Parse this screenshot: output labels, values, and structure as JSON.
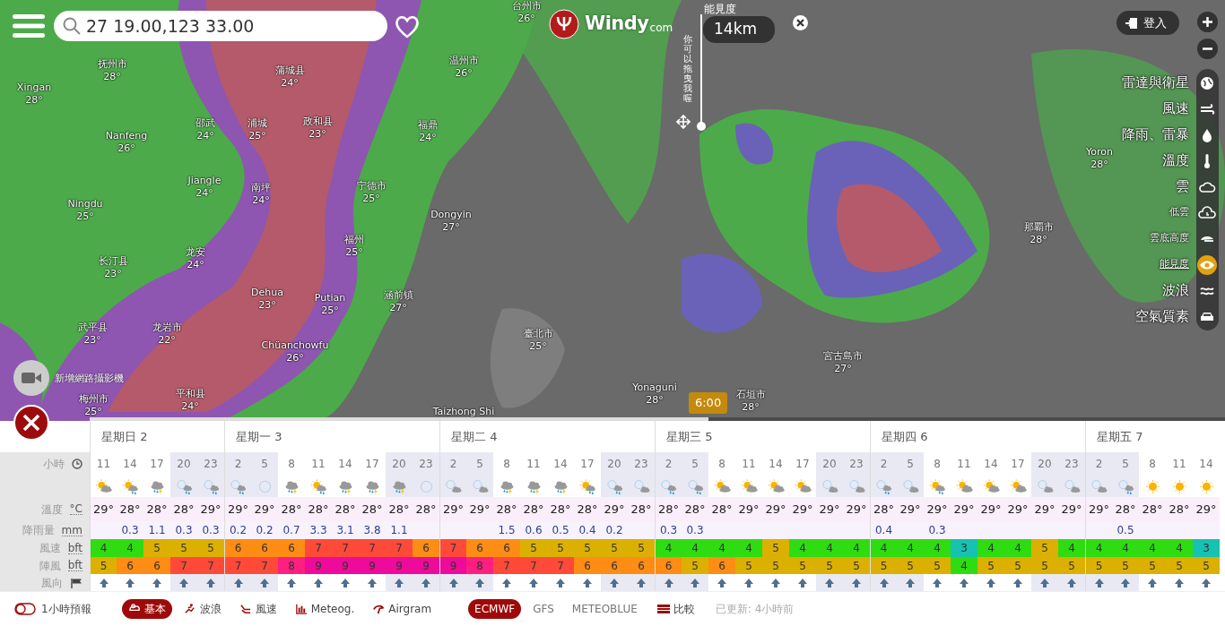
{
  "search": {
    "value": "27 19.00,123 33.00"
  },
  "logo": {
    "name": "Windy",
    "suffix": "com"
  },
  "visibility_widget": {
    "label": "能見度",
    "value": "14km",
    "hint": "你可以拖曳我喔"
  },
  "login": {
    "label": "登入"
  },
  "layers": [
    {
      "label": "雷達與衛星",
      "kind": "major",
      "selected": false
    },
    {
      "label": "風速",
      "kind": "major",
      "selected": false
    },
    {
      "label": "降雨、雷暴",
      "kind": "major",
      "selected": false
    },
    {
      "label": "溫度",
      "kind": "major",
      "selected": false
    },
    {
      "label": "雲",
      "kind": "major",
      "selected": false
    },
    {
      "label": "低雲",
      "kind": "minor",
      "selected": false
    },
    {
      "label": "雲底高度",
      "kind": "minor",
      "selected": false
    },
    {
      "label": "能見度",
      "kind": "minor",
      "selected": true
    },
    {
      "label": "波浪",
      "kind": "major",
      "selected": false
    },
    {
      "label": "空氣質素",
      "kind": "major",
      "selected": false
    }
  ],
  "cities": [
    {
      "name": "抚州市",
      "temp": "28°"
    },
    {
      "name": "Xingan",
      "temp": "28°"
    },
    {
      "name": "蒲城县",
      "temp": "24°"
    },
    {
      "name": "温州市",
      "temp": "26°"
    },
    {
      "name": "台州市",
      "temp": "26°"
    },
    {
      "name": "邵武",
      "temp": "24°"
    },
    {
      "name": "浦城",
      "temp": "25°"
    },
    {
      "name": "政和县",
      "temp": "23°"
    },
    {
      "name": "福鼎",
      "temp": "24°"
    },
    {
      "name": "Nanfeng",
      "temp": "26°"
    },
    {
      "name": "Jiangle",
      "temp": "24°"
    },
    {
      "name": "南坪",
      "temp": "24°"
    },
    {
      "name": "宁德市",
      "temp": "25°"
    },
    {
      "name": "Ningdu",
      "temp": "25°"
    },
    {
      "name": "Dongyin",
      "temp": "27°"
    },
    {
      "name": "福州",
      "temp": "25°"
    },
    {
      "name": "长汀县",
      "temp": "23°"
    },
    {
      "name": "龙安",
      "temp": "24°"
    },
    {
      "name": "Dehua",
      "temp": "23°"
    },
    {
      "name": "Putian",
      "temp": "25°"
    },
    {
      "name": "涵前镇",
      "temp": "27°"
    },
    {
      "name": "武平县",
      "temp": "23°"
    },
    {
      "name": "龙岩市",
      "temp": "22°"
    },
    {
      "name": "Chüanchowfu",
      "temp": "26°"
    },
    {
      "name": "梅州市",
      "temp": "25°"
    },
    {
      "name": "平和县",
      "temp": "24°"
    },
    {
      "name": "臺北市",
      "temp": "25°"
    },
    {
      "name": "Yonaguni",
      "temp": "28°"
    },
    {
      "name": "石垣市",
      "temp": "28°"
    },
    {
      "name": "宮古島市",
      "temp": "27°"
    },
    {
      "name": "Taizhong Shi"
    },
    {
      "name": "那覇市",
      "temp": "28°"
    },
    {
      "name": "Yoron",
      "temp": "28°"
    }
  ],
  "webcam": {
    "label": "新增網路攝影機"
  },
  "timeline": {
    "time": "6:00",
    "level": 0.545
  },
  "forecast": {
    "row_labels": [
      {
        "label": "小時"
      },
      {
        "label": "溫度",
        "unit": "°C"
      },
      {
        "label": "降雨量",
        "unit": "mm"
      },
      {
        "label": "風速",
        "unit": "bft"
      },
      {
        "label": "陣風",
        "unit": "bft"
      },
      {
        "label": "風向"
      }
    ],
    "days": [
      {
        "label": "星期日 2",
        "hours": [
          {
            "hour": "11",
            "kind": "sun_cloud",
            "temp": "29°",
            "wind": "4",
            "gust": "5",
            "night": false
          },
          {
            "hour": "14",
            "kind": "sun_rain",
            "temp": "28°",
            "rain": "0.3",
            "wind": "4",
            "gust": "6",
            "night": false
          },
          {
            "hour": "17",
            "kind": "storm",
            "temp": "28°",
            "rain": "1.1",
            "wind": "5",
            "gust": "6",
            "night": false
          },
          {
            "hour": "20",
            "kind": "moon_rain",
            "temp": "28°",
            "rain": "0.3",
            "wind": "5",
            "gust": "7",
            "night": true
          },
          {
            "hour": "23",
            "kind": "moon_rain",
            "temp": "29°",
            "rain": "0.3",
            "wind": "5",
            "gust": "7",
            "night": true
          }
        ]
      },
      {
        "label": "星期一 3",
        "hours": [
          {
            "hour": "2",
            "kind": "moon_rain",
            "temp": "29°",
            "rain": "0.2",
            "wind": "6",
            "gust": "7",
            "night": true
          },
          {
            "hour": "5",
            "kind": "moon",
            "temp": "29°",
            "rain": "0.2",
            "wind": "6",
            "gust": "7",
            "night": true
          },
          {
            "hour": "8",
            "kind": "storm",
            "temp": "28°",
            "rain": "0.7",
            "wind": "6",
            "gust": "8",
            "night": false
          },
          {
            "hour": "11",
            "kind": "sun_rain",
            "temp": "28°",
            "rain": "3.3",
            "wind": "7",
            "gust": "9",
            "night": false
          },
          {
            "hour": "14",
            "kind": "storm",
            "temp": "28°",
            "rain": "3.1",
            "wind": "7",
            "gust": "9",
            "night": false
          },
          {
            "hour": "17",
            "kind": "storm",
            "temp": "28°",
            "rain": "3.8",
            "wind": "7",
            "gust": "9",
            "night": false
          },
          {
            "hour": "20",
            "kind": "storm",
            "temp": "28°",
            "rain": "1.1",
            "wind": "7",
            "gust": "9",
            "night": true
          },
          {
            "hour": "23",
            "kind": "moon",
            "temp": "28°",
            "wind": "6",
            "gust": "9",
            "night": true
          }
        ]
      },
      {
        "label": "星期二 4",
        "hours": [
          {
            "hour": "2",
            "kind": "moon_cloud",
            "temp": "29°",
            "wind": "7",
            "gust": "9",
            "night": true
          },
          {
            "hour": "5",
            "kind": "moon_cloud",
            "temp": "29°",
            "wind": "6",
            "gust": "8",
            "night": true
          },
          {
            "hour": "8",
            "kind": "storm",
            "temp": "28°",
            "rain": "1.5",
            "wind": "6",
            "gust": "7",
            "night": false
          },
          {
            "hour": "11",
            "kind": "storm",
            "temp": "28°",
            "rain": "0.6",
            "wind": "5",
            "gust": "7",
            "night": false
          },
          {
            "hour": "14",
            "kind": "storm",
            "temp": "28°",
            "rain": "0.5",
            "wind": "5",
            "gust": "7",
            "night": false
          },
          {
            "hour": "17",
            "kind": "sun_rain",
            "temp": "28°",
            "rain": "0.4",
            "wind": "5",
            "gust": "6",
            "night": false
          },
          {
            "hour": "20",
            "kind": "moon_rain",
            "temp": "29°",
            "rain": "0.2",
            "wind": "5",
            "gust": "6",
            "night": true
          },
          {
            "hour": "23",
            "kind": "moon_cloud",
            "temp": "28°",
            "wind": "5",
            "gust": "6",
            "night": true
          }
        ]
      },
      {
        "label": "星期三 5",
        "hours": [
          {
            "hour": "2",
            "kind": "moon_rain",
            "temp": "28°",
            "rain": "0.3",
            "wind": "4",
            "gust": "6",
            "night": true
          },
          {
            "hour": "5",
            "kind": "moon_rain",
            "temp": "28°",
            "rain": "0.3",
            "wind": "4",
            "gust": "5",
            "night": true
          },
          {
            "hour": "8",
            "kind": "sun_cloud",
            "temp": "28°",
            "wind": "4",
            "gust": "6",
            "night": false
          },
          {
            "hour": "11",
            "kind": "sun_cloud",
            "temp": "29°",
            "wind": "4",
            "gust": "5",
            "night": false
          },
          {
            "hour": "14",
            "kind": "sun_cloud",
            "temp": "29°",
            "wind": "5",
            "gust": "5",
            "night": false
          },
          {
            "hour": "17",
            "kind": "sun_cloud",
            "temp": "29°",
            "wind": "4",
            "gust": "5",
            "night": false
          },
          {
            "hour": "20",
            "kind": "moon_cloud",
            "temp": "29°",
            "wind": "4",
            "gust": "5",
            "night": true
          },
          {
            "hour": "23",
            "kind": "moon_cloud",
            "temp": "29°",
            "wind": "4",
            "gust": "5",
            "night": true
          }
        ]
      },
      {
        "label": "星期四 6",
        "hours": [
          {
            "hour": "2",
            "kind": "moon_rain",
            "temp": "28°",
            "rain": "0.4",
            "wind": "4",
            "gust": "5",
            "night": true
          },
          {
            "hour": "5",
            "kind": "moon_cloud",
            "temp": "29°",
            "wind": "4",
            "gust": "5",
            "night": true
          },
          {
            "hour": "8",
            "kind": "sun_rain",
            "temp": "29°",
            "rain": "0.3",
            "wind": "4",
            "gust": "5",
            "night": false
          },
          {
            "hour": "11",
            "kind": "sun_cloud",
            "temp": "29°",
            "wind": "3",
            "gust": "4",
            "night": false
          },
          {
            "hour": "14",
            "kind": "sun_cloud",
            "temp": "29°",
            "wind": "4",
            "gust": "5",
            "night": false
          },
          {
            "hour": "17",
            "kind": "sun_cloud",
            "temp": "29°",
            "wind": "4",
            "gust": "5",
            "night": false
          },
          {
            "hour": "20",
            "kind": "moon_cloud",
            "temp": "29°",
            "wind": "5",
            "gust": "5",
            "night": true
          },
          {
            "hour": "23",
            "kind": "moon_cloud",
            "temp": "29°",
            "wind": "4",
            "gust": "5",
            "night": true
          }
        ]
      },
      {
        "label": "星期五 7",
        "hours": [
          {
            "hour": "2",
            "kind": "moon_cloud",
            "temp": "29°",
            "wind": "4",
            "gust": "5",
            "night": true
          },
          {
            "hour": "5",
            "kind": "moon_rain",
            "temp": "28°",
            "rain": "0.5",
            "wind": "4",
            "gust": "5",
            "night": true
          },
          {
            "hour": "8",
            "kind": "sun",
            "temp": "28°",
            "wind": "4",
            "gust": "5",
            "night": false
          },
          {
            "hour": "11",
            "kind": "sun",
            "temp": "28°",
            "wind": "4",
            "gust": "5",
            "night": false
          },
          {
            "hour": "14",
            "kind": "sun",
            "temp": "29°",
            "wind": "3",
            "gust": "5",
            "night": false
          }
        ]
      }
    ]
  },
  "bottom_bar": {
    "hourly_toggle": {
      "label": "1小時預報",
      "on": false
    },
    "views": [
      {
        "label": "基本",
        "selected": true
      },
      {
        "label": "波浪",
        "selected": false
      },
      {
        "label": "風速",
        "selected": false
      },
      {
        "label": "Meteog.",
        "selected": false
      },
      {
        "label": "Airgram",
        "selected": false
      }
    ],
    "models": [
      {
        "label": "ECMWF",
        "selected": true
      },
      {
        "label": "GFS",
        "selected": false
      },
      {
        "label": "METEOBLUE",
        "selected": false
      }
    ],
    "compare": {
      "label": "比較"
    },
    "updated": "已更新: 4小時前"
  }
}
